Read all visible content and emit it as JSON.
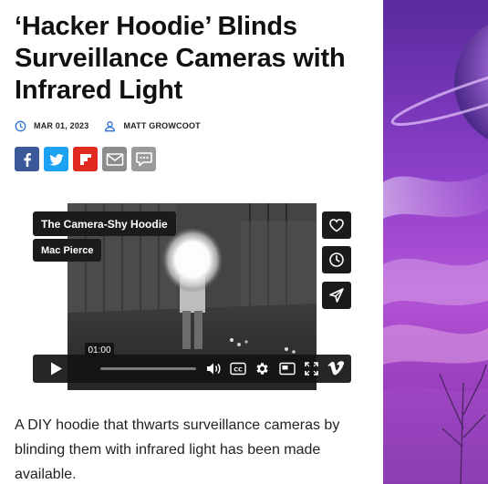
{
  "article": {
    "title": "‘Hacker Hoodie’ Blinds Surveillance Cameras with Infrared Light",
    "date": "MAR 01, 2023",
    "author": "MATT GROWCOOT",
    "share_icons": [
      "facebook-icon",
      "twitter-icon",
      "flipboard-icon",
      "mail-icon",
      "comment-icon"
    ],
    "body": "A DIY hoodie that thwarts surveillance cameras by blinding them with infrared light has been made available."
  },
  "video": {
    "title": "The Camera-Shy Hoodie",
    "author": "Mac Pierce",
    "time_tooltip": "01:00",
    "side_icons": [
      "heart-icon",
      "clock-icon",
      "send-icon"
    ],
    "control_icons": [
      "play-icon",
      "volume-icon",
      "cc-icon",
      "settings-icon",
      "pip-icon",
      "fullscreen-icon",
      "vimeo-logo"
    ],
    "progress": 0.0
  },
  "colors": {
    "facebook": "#3b5998",
    "twitter": "#1da1f2",
    "flipboard": "#e02a20",
    "share_grey": "#8d8d8d",
    "player_bar": "#1b1b1b"
  }
}
